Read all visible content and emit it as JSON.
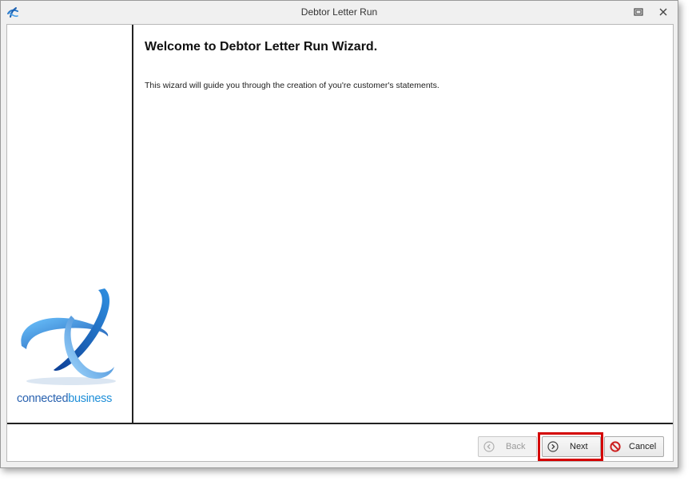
{
  "window": {
    "title": "Debtor Letter Run"
  },
  "wizard": {
    "heading": "Welcome to Debtor Letter Run Wizard.",
    "description": "This wizard will guide you through the creation of you're customer's statements."
  },
  "logo": {
    "word1": "connected",
    "word2": "business"
  },
  "buttons": {
    "back": "Back",
    "next": "Next",
    "cancel": "Cancel"
  },
  "colors": {
    "logo_dark_blue": "#2b63b0",
    "logo_light_blue": "#1f8fd8",
    "highlight_red": "#d40000"
  },
  "icons": {
    "app": "app-logo-icon",
    "restore": "restore-window-icon",
    "close": "close-icon",
    "back": "back-arrow-icon",
    "next": "next-arrow-icon",
    "cancel": "cancel-icon"
  }
}
